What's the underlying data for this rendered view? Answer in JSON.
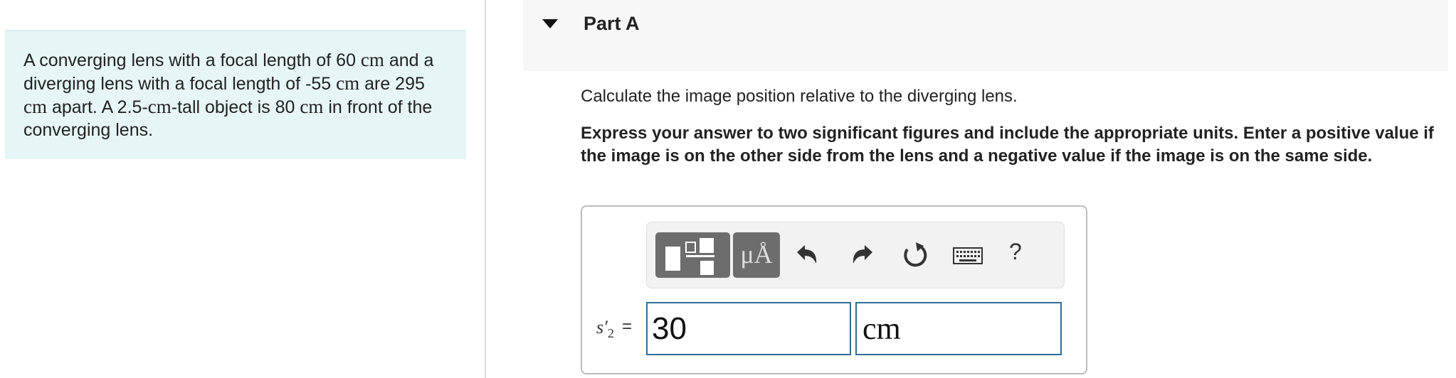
{
  "problem": {
    "seg1": "A converging lens with a focal length of 60 ",
    "unit1": "cm",
    "seg2": " and a diverging lens with a focal length of -55 ",
    "unit2": "cm",
    "seg3": " are 295 ",
    "unit3": "cm",
    "seg4": " apart. A 2.5-",
    "unit4": "cm",
    "seg5": "-tall object is 80 ",
    "unit5": "cm",
    "seg6": " in front of the converging lens."
  },
  "part": {
    "title": "Part A",
    "question": "Calculate the image position relative to the diverging lens.",
    "instructions": "Express your answer to two significant figures and include the appropriate units. Enter a positive value if the image is on the other side from the lens and a negative value if the image is on the same side."
  },
  "toolbar": {
    "units_label": "μÅ",
    "help_label": "?",
    "icons": [
      "fraction-template-icon",
      "units-icon",
      "undo-icon",
      "redo-icon",
      "reset-icon",
      "keyboard-icon",
      "help-icon"
    ]
  },
  "answer": {
    "variable": "s",
    "variable_sub": "2",
    "prime": "′",
    "equals": "=",
    "value": "30",
    "unit": "cm"
  },
  "colors": {
    "problem_bg": "#e6f5f5",
    "input_border": "#2b6f95",
    "toolbar_button": "#6d6d6d"
  }
}
